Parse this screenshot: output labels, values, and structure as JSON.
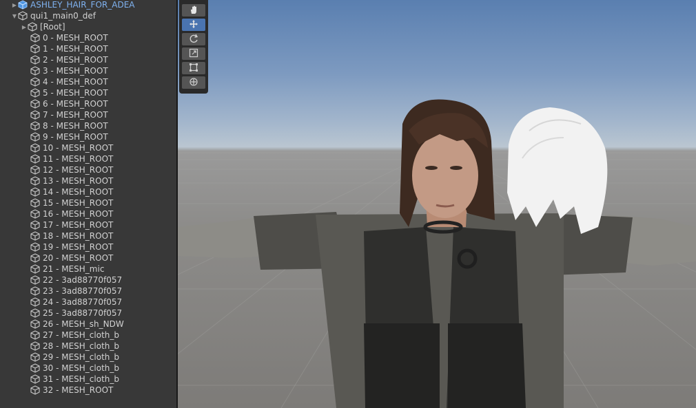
{
  "hierarchy": {
    "items": [
      {
        "label": "ASHLEY_HAIR_FOR_ADEA",
        "depth": 0,
        "arrow": "right",
        "icon": "prefab-cube-icon",
        "color": "#7fb2f0"
      },
      {
        "label": "qui1_main0_def",
        "depth": 0,
        "arrow": "down",
        "icon": "cube-icon"
      },
      {
        "label": "[Root]",
        "depth": 1,
        "arrow": "right",
        "icon": "cube-icon"
      },
      {
        "label": "0 - MESH_ROOT",
        "depth": 2,
        "arrow": "",
        "icon": "cube-icon"
      },
      {
        "label": "1 - MESH_ROOT",
        "depth": 2,
        "arrow": "",
        "icon": "cube-icon"
      },
      {
        "label": "2 - MESH_ROOT",
        "depth": 2,
        "arrow": "",
        "icon": "cube-icon"
      },
      {
        "label": "3 - MESH_ROOT",
        "depth": 2,
        "arrow": "",
        "icon": "cube-icon"
      },
      {
        "label": "4 - MESH_ROOT",
        "depth": 2,
        "arrow": "",
        "icon": "cube-icon"
      },
      {
        "label": "5 - MESH_ROOT",
        "depth": 2,
        "arrow": "",
        "icon": "cube-icon"
      },
      {
        "label": "6 - MESH_ROOT",
        "depth": 2,
        "arrow": "",
        "icon": "cube-icon"
      },
      {
        "label": "7 - MESH_ROOT",
        "depth": 2,
        "arrow": "",
        "icon": "cube-icon"
      },
      {
        "label": "8 - MESH_ROOT",
        "depth": 2,
        "arrow": "",
        "icon": "cube-icon"
      },
      {
        "label": "9 - MESH_ROOT",
        "depth": 2,
        "arrow": "",
        "icon": "cube-icon"
      },
      {
        "label": "10 - MESH_ROOT",
        "depth": 2,
        "arrow": "",
        "icon": "cube-icon"
      },
      {
        "label": "11 - MESH_ROOT",
        "depth": 2,
        "arrow": "",
        "icon": "cube-icon"
      },
      {
        "label": "12 - MESH_ROOT",
        "depth": 2,
        "arrow": "",
        "icon": "cube-icon"
      },
      {
        "label": "13 - MESH_ROOT",
        "depth": 2,
        "arrow": "",
        "icon": "cube-icon"
      },
      {
        "label": "14 - MESH_ROOT",
        "depth": 2,
        "arrow": "",
        "icon": "cube-icon"
      },
      {
        "label": "15 - MESH_ROOT",
        "depth": 2,
        "arrow": "",
        "icon": "cube-icon"
      },
      {
        "label": "16 - MESH_ROOT",
        "depth": 2,
        "arrow": "",
        "icon": "cube-icon"
      },
      {
        "label": "17 - MESH_ROOT",
        "depth": 2,
        "arrow": "",
        "icon": "cube-icon"
      },
      {
        "label": "18 - MESH_ROOT",
        "depth": 2,
        "arrow": "",
        "icon": "cube-icon"
      },
      {
        "label": "19 - MESH_ROOT",
        "depth": 2,
        "arrow": "",
        "icon": "cube-icon"
      },
      {
        "label": "20 - MESH_ROOT",
        "depth": 2,
        "arrow": "",
        "icon": "cube-icon"
      },
      {
        "label": "21 - MESH_mic",
        "depth": 2,
        "arrow": "",
        "icon": "cube-icon"
      },
      {
        "label": "22 - 3ad88770f057",
        "depth": 2,
        "arrow": "",
        "icon": "cube-icon"
      },
      {
        "label": "23 - 3ad88770f057",
        "depth": 2,
        "arrow": "",
        "icon": "cube-icon"
      },
      {
        "label": "24 - 3ad88770f057",
        "depth": 2,
        "arrow": "",
        "icon": "cube-icon"
      },
      {
        "label": "25 - 3ad88770f057",
        "depth": 2,
        "arrow": "",
        "icon": "cube-icon"
      },
      {
        "label": "26 - MESH_sh_NDW",
        "depth": 2,
        "arrow": "",
        "icon": "cube-icon"
      },
      {
        "label": "27 - MESH_cloth_b",
        "depth": 2,
        "arrow": "",
        "icon": "cube-icon"
      },
      {
        "label": "28 - MESH_cloth_b",
        "depth": 2,
        "arrow": "",
        "icon": "cube-icon"
      },
      {
        "label": "29 - MESH_cloth_b",
        "depth": 2,
        "arrow": "",
        "icon": "cube-icon"
      },
      {
        "label": "30 - MESH_cloth_b",
        "depth": 2,
        "arrow": "",
        "icon": "cube-icon"
      },
      {
        "label": "31 - MESH_cloth_b",
        "depth": 2,
        "arrow": "",
        "icon": "cube-icon"
      },
      {
        "label": "32 - MESH_ROOT",
        "depth": 2,
        "arrow": "",
        "icon": "cube-icon"
      }
    ]
  },
  "scene_tools": [
    {
      "name": "hand-tool",
      "icon": "hand-icon",
      "active": false
    },
    {
      "name": "move-tool",
      "icon": "move-icon",
      "active": true
    },
    {
      "name": "rotate-tool",
      "icon": "rotate-icon",
      "active": false
    },
    {
      "name": "scale-tool",
      "icon": "scale-icon",
      "active": false
    },
    {
      "name": "rect-tool",
      "icon": "rect-icon",
      "active": false
    },
    {
      "name": "transform-tool",
      "icon": "transform-icon",
      "active": false
    }
  ],
  "colors": {
    "panel_bg": "#383838",
    "text": "#d2d2d2",
    "prefab_text": "#7fb2f0",
    "active_tool": "#4a74b0",
    "sky_top": "#5a7fb0",
    "ground": "#8d8c8a"
  }
}
